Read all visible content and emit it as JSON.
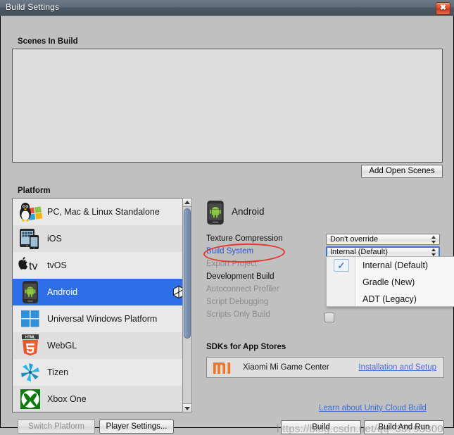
{
  "window": {
    "title": "Build Settings",
    "close_icon": "close-icon"
  },
  "scenes": {
    "header": "Scenes In Build",
    "items": [],
    "add_open_scenes_label": "Add Open Scenes"
  },
  "platform": {
    "header": "Platform",
    "items": [
      {
        "label": "PC, Mac & Linux Standalone",
        "icon": "linux-windows-icon",
        "selected": false
      },
      {
        "label": "iOS",
        "icon": "ios-device-icon",
        "selected": false
      },
      {
        "label": "tvOS",
        "icon": "apple-tv-icon",
        "selected": false
      },
      {
        "label": "Android",
        "icon": "android-phone-icon",
        "selected": true,
        "badge_icon": "unity-logo-icon"
      },
      {
        "label": "Universal Windows Platform",
        "icon": "windows-icon",
        "selected": false
      },
      {
        "label": "WebGL",
        "icon": "html5-icon",
        "selected": false
      },
      {
        "label": "Tizen",
        "icon": "tizen-icon",
        "selected": false
      },
      {
        "label": "Xbox One",
        "icon": "xbox-icon",
        "selected": false
      }
    ],
    "scrollbar": {
      "up_icon": "scroll-up-arrow-icon",
      "down_icon": "scroll-down-arrow-icon"
    }
  },
  "footer_left": {
    "switch_platform_label": "Switch Platform",
    "switch_platform_disabled": true,
    "player_settings_label": "Player Settings..."
  },
  "details": {
    "platform_title": "Android",
    "platform_icon": "android-phone-icon",
    "options": [
      {
        "label": "Texture Compression",
        "state": "normal"
      },
      {
        "label": "Build System",
        "state": "link"
      },
      {
        "label": "Export Project",
        "state": "disabled"
      },
      {
        "label": "Development Build",
        "state": "normal"
      },
      {
        "label": "Autoconnect Profiler",
        "state": "disabled"
      },
      {
        "label": "Script Debugging",
        "state": "disabled"
      },
      {
        "label": "Scripts Only Build",
        "state": "disabled"
      }
    ],
    "texture_compression_value": "Don't override",
    "build_system_value": "Internal (Default)",
    "development_build_checked": false
  },
  "dropdown": {
    "open": true,
    "selected": "Internal (Default)",
    "check_icon": "checkmark-icon",
    "options": [
      "Internal (Default)",
      "Gradle (New)",
      "ADT (Legacy)"
    ]
  },
  "sdks": {
    "header": "SDKs for App Stores",
    "rows": [
      {
        "name": "Xiaomi Mi Game Center",
        "icon": "xiaomi-mi-logo-icon",
        "link": "Installation and Setup"
      }
    ]
  },
  "footer_right": {
    "cloud_build_link": "Learn about Unity Cloud Build",
    "build_label": "Build",
    "build_and_run_label": "Build And Run"
  },
  "annotation": {
    "ellipse_color": "#e8342a",
    "target": "Build System"
  },
  "watermark": {
    "text": "https://blog.csdn.net/qq_33793300"
  },
  "colors": {
    "selection_blue": "#2e6fe8",
    "link_blue": "#3c6fd8",
    "window_bg": "#c0c0c0",
    "titlebar": "#4c5966",
    "close_red": "#de4a28"
  }
}
